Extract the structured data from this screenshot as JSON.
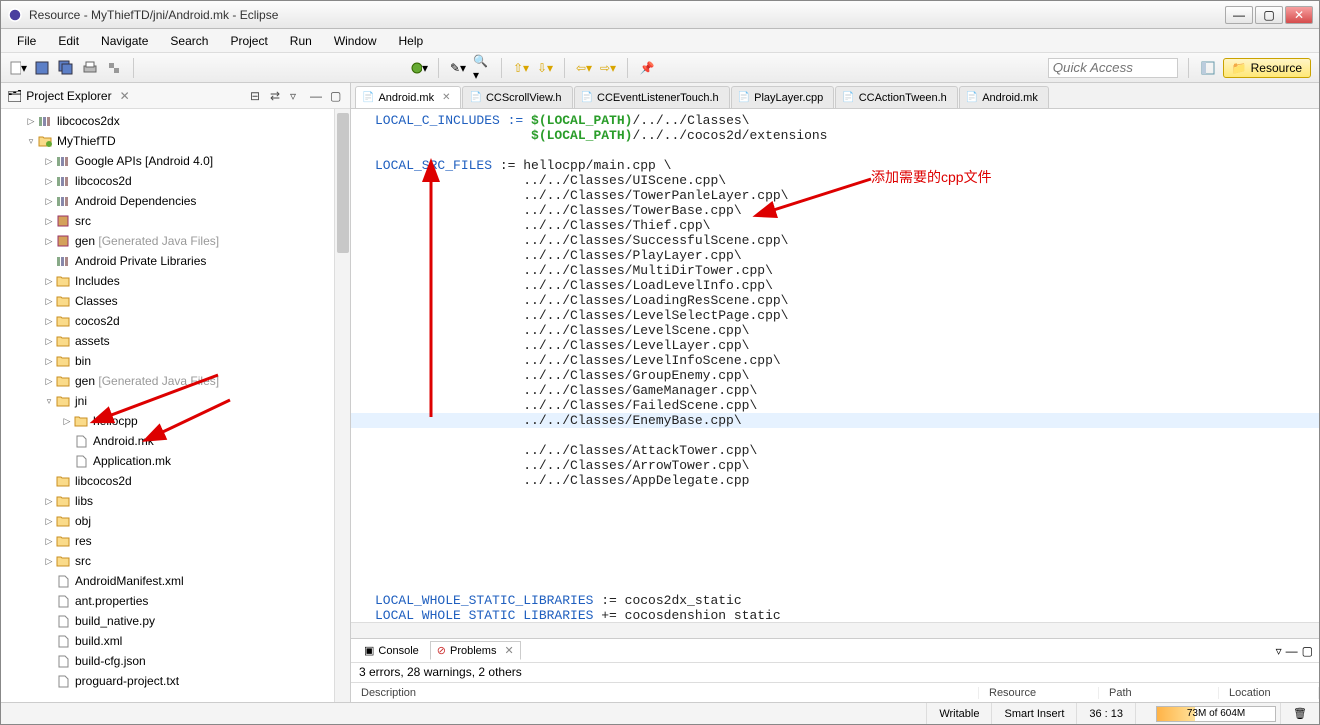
{
  "window": {
    "title": "Resource - MyThiefTD/jni/Android.mk - Eclipse"
  },
  "menu": [
    "File",
    "Edit",
    "Navigate",
    "Search",
    "Project",
    "Run",
    "Window",
    "Help"
  ],
  "toolbar": {
    "quick_access_placeholder": "Quick Access",
    "resource_pill": "Resource"
  },
  "project_explorer": {
    "title": "Project Explorer",
    "nodes": [
      {
        "depth": 1,
        "tri": "▷",
        "icon": "lib",
        "label": "libcocos2dx"
      },
      {
        "depth": 1,
        "tri": "▿",
        "icon": "proj",
        "label": "MyThiefTD"
      },
      {
        "depth": 2,
        "tri": "▷",
        "icon": "lib",
        "label": "Google APIs [Android 4.0]"
      },
      {
        "depth": 2,
        "tri": "▷",
        "icon": "lib",
        "label": "libcocos2d"
      },
      {
        "depth": 2,
        "tri": "▷",
        "icon": "lib",
        "label": "Android Dependencies"
      },
      {
        "depth": 2,
        "tri": "▷",
        "icon": "pkg",
        "label": "src"
      },
      {
        "depth": 2,
        "tri": "▷",
        "icon": "pkg",
        "label": "gen ",
        "gen": "[Generated Java Files]"
      },
      {
        "depth": 2,
        "tri": "",
        "icon": "lib",
        "label": "Android Private Libraries"
      },
      {
        "depth": 2,
        "tri": "▷",
        "icon": "folder",
        "label": "Includes"
      },
      {
        "depth": 2,
        "tri": "▷",
        "icon": "folder",
        "label": "Classes"
      },
      {
        "depth": 2,
        "tri": "▷",
        "icon": "folder",
        "label": "cocos2d"
      },
      {
        "depth": 2,
        "tri": "▷",
        "icon": "folder",
        "label": "assets"
      },
      {
        "depth": 2,
        "tri": "▷",
        "icon": "folder",
        "label": "bin"
      },
      {
        "depth": 2,
        "tri": "▷",
        "icon": "folder",
        "label": "gen ",
        "gen": "[Generated Java Files]"
      },
      {
        "depth": 2,
        "tri": "▿",
        "icon": "folder-open",
        "label": "jni"
      },
      {
        "depth": 3,
        "tri": "▷",
        "icon": "folder",
        "label": "hellocpp"
      },
      {
        "depth": 3,
        "tri": "",
        "icon": "file",
        "label": "Android.mk"
      },
      {
        "depth": 3,
        "tri": "",
        "icon": "file",
        "label": "Application.mk"
      },
      {
        "depth": 2,
        "tri": "",
        "icon": "folder",
        "label": "libcocos2d"
      },
      {
        "depth": 2,
        "tri": "▷",
        "icon": "folder",
        "label": "libs"
      },
      {
        "depth": 2,
        "tri": "▷",
        "icon": "folder",
        "label": "obj"
      },
      {
        "depth": 2,
        "tri": "▷",
        "icon": "folder",
        "label": "res"
      },
      {
        "depth": 2,
        "tri": "▷",
        "icon": "folder",
        "label": "src"
      },
      {
        "depth": 2,
        "tri": "",
        "icon": "file",
        "label": "AndroidManifest.xml"
      },
      {
        "depth": 2,
        "tri": "",
        "icon": "file",
        "label": "ant.properties"
      },
      {
        "depth": 2,
        "tri": "",
        "icon": "file",
        "label": "build_native.py"
      },
      {
        "depth": 2,
        "tri": "",
        "icon": "file",
        "label": "build.xml"
      },
      {
        "depth": 2,
        "tri": "",
        "icon": "file",
        "label": "build-cfg.json"
      },
      {
        "depth": 2,
        "tri": "",
        "icon": "file",
        "label": "proguard-project.txt"
      }
    ]
  },
  "editor_tabs": [
    {
      "label": "Android.mk",
      "active": true,
      "close": true
    },
    {
      "label": "CCScrollView.h",
      "active": false
    },
    {
      "label": "CCEventListenerTouch.h",
      "active": false
    },
    {
      "label": "PlayLayer.cpp",
      "active": false
    },
    {
      "label": "CCActionTween.h",
      "active": false
    },
    {
      "label": "Android.mk",
      "active": false
    }
  ],
  "code": {
    "c_includes_lhs": "LOCAL_C_INCLUDES := ",
    "local_path": "$(LOCAL_PATH)",
    "inc_tail1": "/../../Classes\\",
    "inc_indent": "                    ",
    "inc_tail2": "/../../cocos2d/extensions",
    "src_lhs": "LOCAL_SRC_FILES := hellocpp/main.cpp \\",
    "src_indent": "                   ",
    "src_files": [
      "../../Classes/UIScene.cpp\\",
      "../../Classes/TowerPanleLayer.cpp\\",
      "../../Classes/TowerBase.cpp\\",
      "../../Classes/Thief.cpp\\",
      "../../Classes/SuccessfulScene.cpp\\",
      "../../Classes/PlayLayer.cpp\\",
      "../../Classes/MultiDirTower.cpp\\",
      "../../Classes/LoadLevelInfo.cpp\\",
      "../../Classes/LoadingResScene.cpp\\",
      "../../Classes/LevelSelectPage.cpp\\",
      "../../Classes/LevelScene.cpp\\",
      "../../Classes/LevelLayer.cpp\\",
      "../../Classes/LevelInfoScene.cpp\\",
      "../../Classes/GroupEnemy.cpp\\",
      "../../Classes/GameManager.cpp\\",
      "../../Classes/FailedScene.cpp\\",
      "../../Classes/EnemyBase.cpp\\",
      "../../Classes/AttackTower.cpp\\",
      "../../Classes/ArrowTower.cpp\\",
      "../../Classes/AppDelegate.cpp"
    ],
    "highlight_index": 16,
    "whole_static_1": "LOCAL_WHOLE_STATIC_LIBRARIES := cocos2dx_static",
    "whole_static_2": "LOCAL WHOLE STATIC LIBRARIES += cocosdenshion static"
  },
  "annotation": {
    "text": "添加需要的cpp文件"
  },
  "bottom_panel": {
    "tabs": {
      "console": "Console",
      "problems": "Problems"
    },
    "summary": "3 errors, 28 warnings, 2 others",
    "columns": [
      "Description",
      "Resource",
      "Path",
      "Location"
    ]
  },
  "status": {
    "writable": "Writable",
    "insert": "Smart Insert",
    "pos": "36 : 13",
    "mem": "73M of 604M"
  }
}
